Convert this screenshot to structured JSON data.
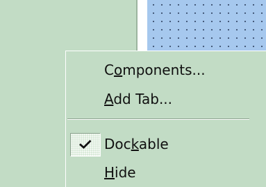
{
  "background": {
    "panel_color": "#c2dcc5",
    "grid_color": "#a6c8ee",
    "grid_dot_color": "#3c4f6e"
  },
  "context_menu": {
    "items": [
      {
        "label": "Components...",
        "mnemonic": "o"
      },
      {
        "label": "Add Tab...",
        "mnemonic": "A"
      },
      {
        "label": "Dockable",
        "mnemonic": "k",
        "checked": true,
        "icon": "checkmark-icon"
      },
      {
        "label": "Hide",
        "mnemonic": "H"
      }
    ]
  }
}
